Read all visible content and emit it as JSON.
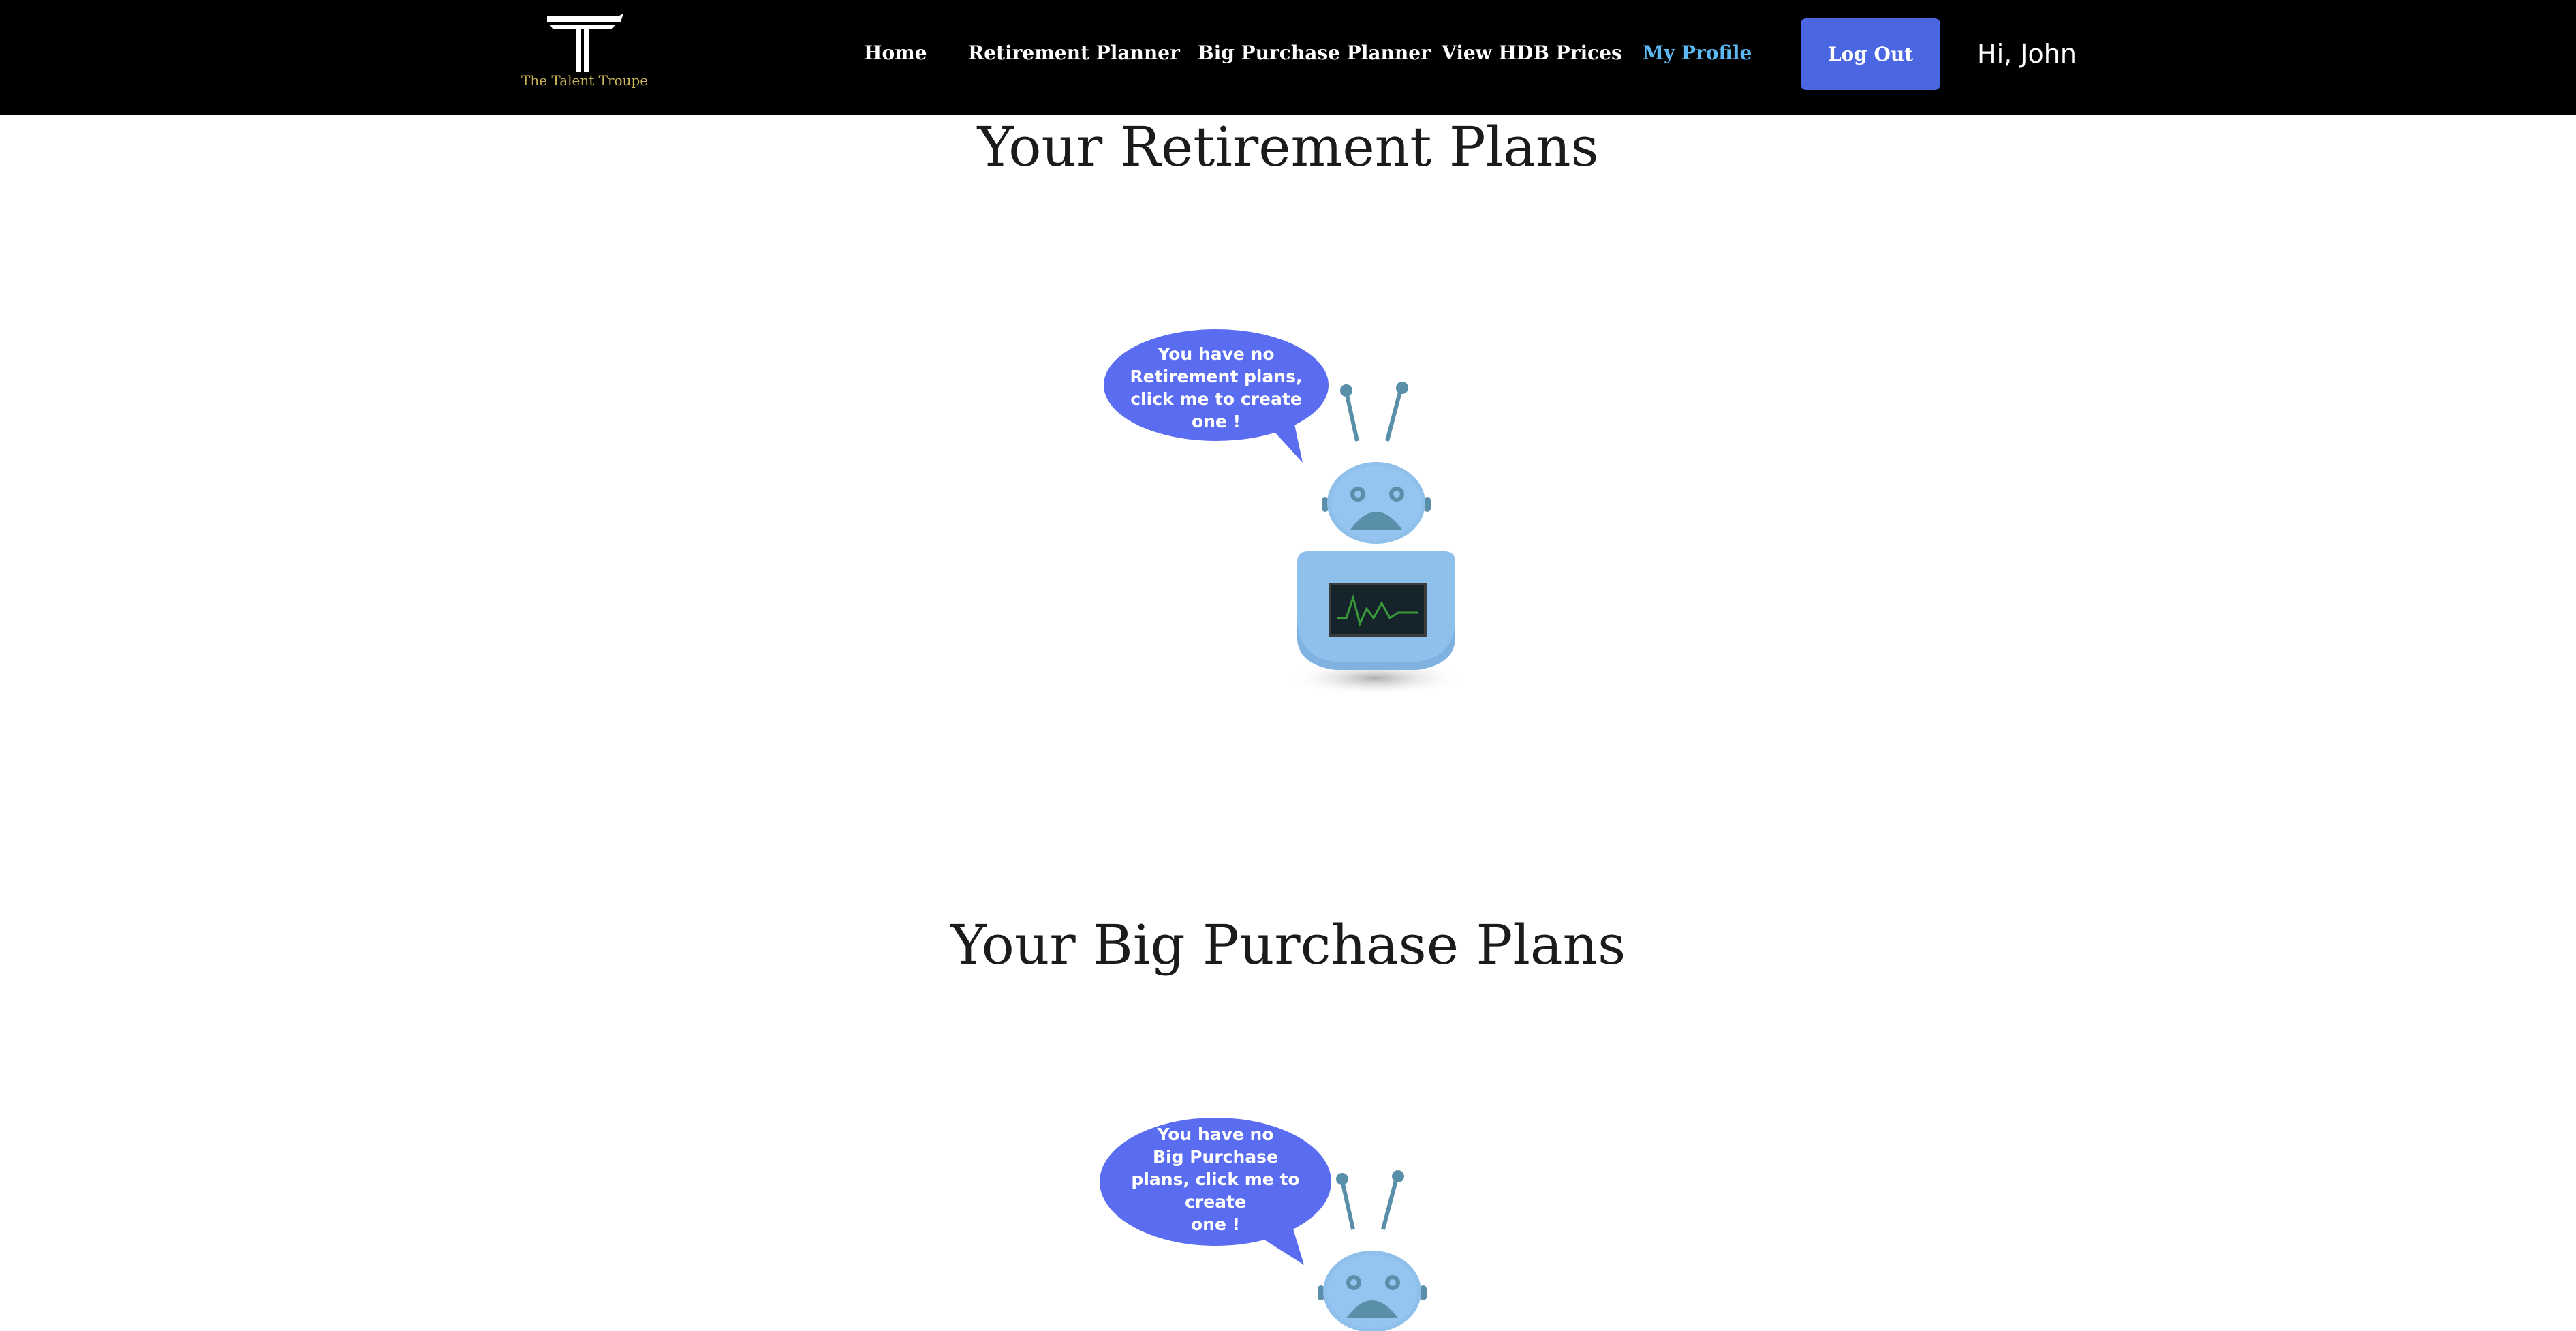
{
  "header": {
    "logo_text": "The Talent Troupe",
    "nav": [
      {
        "label": "Home"
      },
      {
        "label": "Retirement Planner"
      },
      {
        "label": "Big Purchase Planner"
      },
      {
        "label": "View HDB Prices"
      },
      {
        "label": "My Profile",
        "active": true
      }
    ],
    "logout_label": "Log Out",
    "greeting": "Hi, John"
  },
  "retirement": {
    "title": "Your Retirement Plans",
    "bubble_lines": [
      "You have no",
      "Retirement plans,",
      "click me to create",
      "one !"
    ]
  },
  "big_purchase": {
    "title": "Your Big Purchase Plans",
    "bubble_lines": [
      "You have no",
      "Big Purchase",
      "plans, click me to",
      "create",
      "one !"
    ]
  },
  "colors": {
    "navbar_bg": "#000000",
    "accent": "#4a67e1",
    "active_link": "#5bb8f0",
    "robot_body": "#8fc0ec",
    "robot_dark": "#5a8faa",
    "bubble": "#5a6df0"
  }
}
